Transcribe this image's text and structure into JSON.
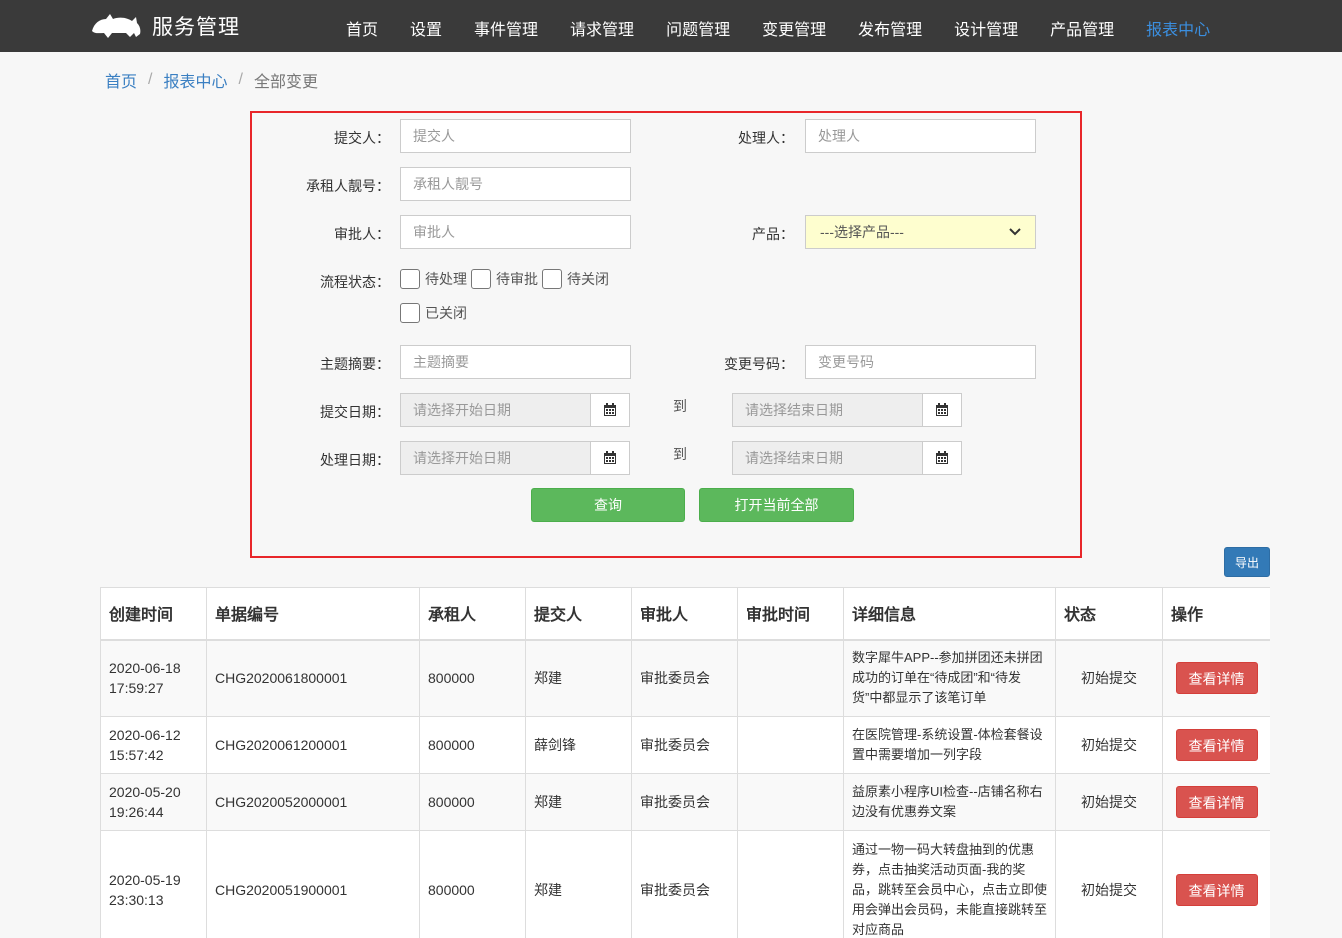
{
  "header": {
    "brand": "服务管理",
    "nav": [
      "首页",
      "设置",
      "事件管理",
      "请求管理",
      "问题管理",
      "变更管理",
      "发布管理",
      "设计管理",
      "产品管理",
      "报表中心"
    ],
    "active_index": 9
  },
  "breadcrumb": [
    "首页",
    "报表中心",
    "全部变更"
  ],
  "form": {
    "submitter_label": "提交人：",
    "submitter_placeholder": "提交人",
    "handler_label": "处理人：",
    "handler_placeholder": "处理人",
    "tenant_label": "承租人靓号：",
    "tenant_placeholder": "承租人靓号",
    "approver_label": "审批人：",
    "approver_placeholder": "审批人",
    "product_label": "产品：",
    "product_selected": "---选择产品---",
    "status_label": "流程状态：",
    "status_options": [
      "待处理",
      "待审批",
      "待关闭",
      "已关闭"
    ],
    "subject_label": "主题摘要：",
    "subject_placeholder": "主题摘要",
    "change_no_label": "变更号码：",
    "change_no_placeholder": "变更号码",
    "submit_date_label": "提交日期：",
    "handle_date_label": "处理日期：",
    "start_placeholder": "请选择开始日期",
    "end_placeholder": "请选择结束日期",
    "to": "到",
    "query_btn": "查询",
    "open_all_btn": "打开当前全部"
  },
  "export_btn": "导出",
  "table": {
    "headers": [
      "创建时间",
      "单据编号",
      "承租人",
      "提交人",
      "审批人",
      "审批时间",
      "详细信息",
      "状态",
      "操作"
    ],
    "action_label": "查看详情",
    "rows": [
      {
        "date": "2020-06-18",
        "time": "17:59:27",
        "no": "CHG2020061800001",
        "tenant": "800000",
        "submitter": "郑建",
        "approver": "审批委员会",
        "approve_time": "",
        "detail": "数字犀牛APP--参加拼团还未拼团成功的订单在“待成团”和“待发货”中都显示了该笔订单",
        "status": "初始提交"
      },
      {
        "date": "2020-06-12",
        "time": "15:57:42",
        "no": "CHG2020061200001",
        "tenant": "800000",
        "submitter": "薛剑锋",
        "approver": "审批委员会",
        "approve_time": "",
        "detail": "在医院管理-系统设置-体检套餐设置中需要增加一列字段",
        "status": "初始提交"
      },
      {
        "date": "2020-05-20",
        "time": "19:26:44",
        "no": "CHG2020052000001",
        "tenant": "800000",
        "submitter": "郑建",
        "approver": "审批委员会",
        "approve_time": "",
        "detail": "益原素小程序UI检查--店铺名称右边没有优惠券文案",
        "status": "初始提交"
      },
      {
        "date": "2020-05-19",
        "time": "23:30:13",
        "no": "CHG2020051900001",
        "tenant": "800000",
        "submitter": "郑建",
        "approver": "审批委员会",
        "approve_time": "",
        "detail": "通过一物一码大转盘抽到的优惠券，点击抽奖活动页面-我的奖品，跳转至会员中心，点击立即使用会弹出会员码，未能直接跳转至对应商品",
        "status": "初始提交"
      }
    ]
  }
}
